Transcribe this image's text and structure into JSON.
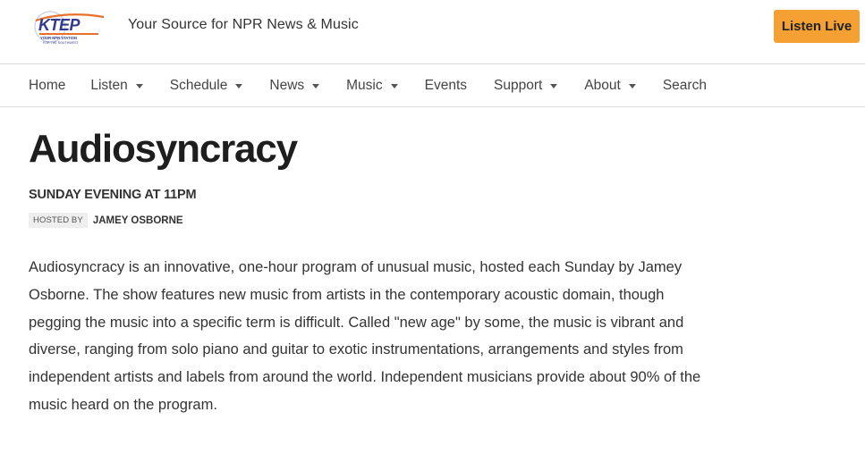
{
  "header": {
    "logo_text": "KTEP",
    "logo_subtext": "YOUR NPR STATION FOR THE SOUTHWEST",
    "tagline": "Your Source for NPR News & Music",
    "listen_live_label": "Listen Live",
    "accent_color": "#f5a033"
  },
  "nav": {
    "items": [
      {
        "label": "Home",
        "dropdown": false
      },
      {
        "label": "Listen",
        "dropdown": true
      },
      {
        "label": "Schedule",
        "dropdown": true
      },
      {
        "label": "News",
        "dropdown": true
      },
      {
        "label": "Music",
        "dropdown": true
      },
      {
        "label": "Events",
        "dropdown": false
      },
      {
        "label": "Support",
        "dropdown": true
      },
      {
        "label": "About",
        "dropdown": true
      },
      {
        "label": "Search",
        "dropdown": false
      }
    ]
  },
  "program": {
    "title": "Audiosyncracy",
    "schedule": "SUNDAY EVENING AT 11PM",
    "hosted_by_label": "HOSTED BY",
    "host_name": "JAMEY OSBORNE",
    "description": "Audiosyncracy is an innovative, one-hour program of unusual music, hosted each Sunday by Jamey Osborne. The show features new music from artists in the contemporary acoustic domain, though pegging the music into a specific term is difficult. Called \"new age\" by some, the music is vibrant and diverse, ranging from solo piano and guitar to exotic instrumentations, arrangements and styles from independent artists and labels from around the world. Independent musicians provide about 90% of the music heard on the program."
  }
}
